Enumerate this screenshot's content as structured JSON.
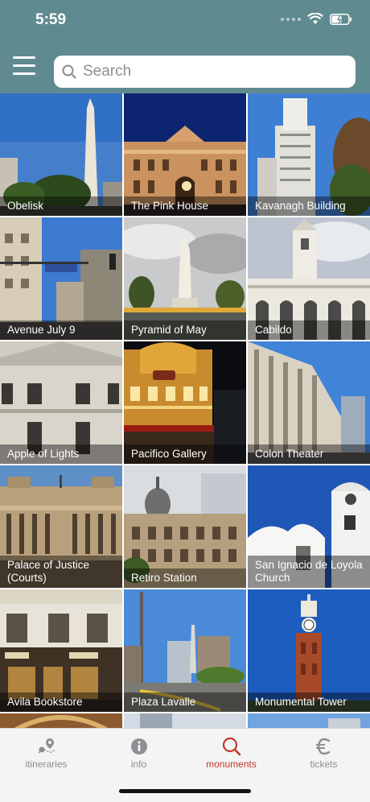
{
  "status": {
    "time": "5:59"
  },
  "header": {
    "search_placeholder": "Search"
  },
  "monuments": [
    {
      "name": "Obelisk",
      "icon": "obelisk-photo"
    },
    {
      "name": "The Pink House",
      "icon": "pink-house-photo"
    },
    {
      "name": "Kavanagh Building",
      "icon": "kavanagh-photo"
    },
    {
      "name": "Avenue July 9",
      "icon": "avenue-photo"
    },
    {
      "name": "Pyramid of May",
      "icon": "pyramid-photo"
    },
    {
      "name": "Cabildo",
      "icon": "cabildo-photo"
    },
    {
      "name": "Apple of Lights",
      "icon": "apple-of-lights-photo"
    },
    {
      "name": "Pacifico Gallery",
      "icon": "pacifico-photo"
    },
    {
      "name": "Colon Theater",
      "icon": "colon-theater-photo"
    },
    {
      "name": "Palace of Justice (Courts)",
      "icon": "palace-justice-photo"
    },
    {
      "name": "Retiro Station",
      "icon": "retiro-photo"
    },
    {
      "name": "San Ignacio de Loyola Church",
      "icon": "san-ignacio-photo"
    },
    {
      "name": "Avila Bookstore",
      "icon": "avila-photo"
    },
    {
      "name": "Plaza Lavalle",
      "icon": "plaza-lavalle-photo"
    },
    {
      "name": "Monumental Tower",
      "icon": "monumental-tower-photo"
    }
  ],
  "tabs": [
    {
      "label": "itineraries",
      "icon": "map-pin-icon"
    },
    {
      "label": "info",
      "icon": "info-icon"
    },
    {
      "label": "monuments",
      "icon": "search-icon",
      "active": true
    },
    {
      "label": "tickets",
      "icon": "euro-icon"
    }
  ],
  "colors": {
    "header": "#5f8a90",
    "active_tab": "#c0392b",
    "inactive_tab": "#8e8e93"
  }
}
